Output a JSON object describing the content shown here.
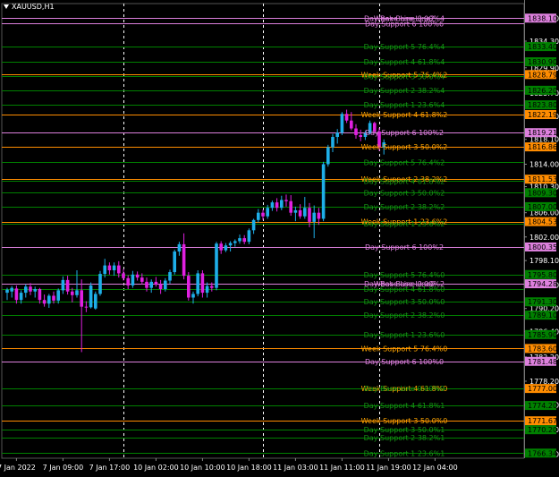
{
  "symbol_label": "XAUUSD,H1",
  "colors": {
    "background": "#000000",
    "bull_candle": "#1eaee8",
    "bear_candle": "#e020e0",
    "grid": "#ffffff",
    "axis_text": "#ffffff",
    "day_line": "#008000",
    "day_text": "#159315",
    "week_line": "#ff8c00",
    "week_text": "#ffa500",
    "pivot_line": "#dd80dd",
    "pivot_text": "#e080e0"
  },
  "chart_data": {
    "type": "candlestick",
    "symbol": "XAUUSD",
    "timeframe": "H1",
    "ylim": [
      1765.5,
      1840.5
    ],
    "price_ticks": [
      "1838.10",
      "1834.30",
      "1829.90",
      "1825.70",
      "1821.90",
      "1818.10",
      "1814.00",
      "1810.30",
      "1806.00",
      "1802.00",
      "1798.10",
      "1794.10",
      "1790.20",
      "1786.40",
      "1782.20",
      "1778.20",
      "1774.30",
      "1770.20",
      "1766.20"
    ],
    "time_labels": [
      {
        "label": "7 Jan 2022",
        "bar": 2
      },
      {
        "label": "7 Jan 09:00",
        "bar": 12
      },
      {
        "label": "7 Jan 17:00",
        "bar": 22
      },
      {
        "label": "10 Jan 02:00",
        "bar": 32
      },
      {
        "label": "10 Jan 10:00",
        "bar": 42
      },
      {
        "label": "10 Jan 18:00",
        "bar": 52
      },
      {
        "label": "11 Jan 03:00",
        "bar": 62
      },
      {
        "label": "11 Jan 11:00",
        "bar": 72
      },
      {
        "label": "11 Jan 19:00",
        "bar": 82
      },
      {
        "label": "12 Jan 04:00",
        "bar": 92
      }
    ],
    "period_separators": [
      25,
      55,
      80
    ],
    "candles": [
      {
        "o": 1792.8,
        "h": 1793.6,
        "l": 1791.6,
        "c": 1793.3
      },
      {
        "o": 1793.0,
        "h": 1793.9,
        "l": 1792.0,
        "c": 1793.6
      },
      {
        "o": 1793.5,
        "h": 1794.0,
        "l": 1791.0,
        "c": 1791.6
      },
      {
        "o": 1791.6,
        "h": 1793.2,
        "l": 1791.0,
        "c": 1792.8
      },
      {
        "o": 1792.8,
        "h": 1794.2,
        "l": 1792.0,
        "c": 1793.8
      },
      {
        "o": 1793.8,
        "h": 1794.4,
        "l": 1792.4,
        "c": 1793.0
      },
      {
        "o": 1793.0,
        "h": 1793.8,
        "l": 1792.0,
        "c": 1793.4
      },
      {
        "o": 1793.4,
        "h": 1793.6,
        "l": 1791.0,
        "c": 1791.6
      },
      {
        "o": 1791.6,
        "h": 1792.5,
        "l": 1790.5,
        "c": 1791.0
      },
      {
        "o": 1791.0,
        "h": 1792.6,
        "l": 1790.3,
        "c": 1792.3
      },
      {
        "o": 1792.3,
        "h": 1793.0,
        "l": 1791.0,
        "c": 1791.5
      },
      {
        "o": 1791.5,
        "h": 1793.5,
        "l": 1791.0,
        "c": 1793.2
      },
      {
        "o": 1793.2,
        "h": 1795.5,
        "l": 1792.6,
        "c": 1794.9
      },
      {
        "o": 1794.9,
        "h": 1795.6,
        "l": 1792.5,
        "c": 1793.0
      },
      {
        "o": 1793.0,
        "h": 1793.6,
        "l": 1791.2,
        "c": 1792.4
      },
      {
        "o": 1792.4,
        "h": 1796.5,
        "l": 1792.0,
        "c": 1793.2
      },
      {
        "o": 1793.2,
        "h": 1795.0,
        "l": 1783.0,
        "c": 1790.5
      },
      {
        "o": 1790.5,
        "h": 1791.4,
        "l": 1789.6,
        "c": 1790.4
      },
      {
        "o": 1790.4,
        "h": 1794.5,
        "l": 1790.2,
        "c": 1794.0
      },
      {
        "o": 1790.2,
        "h": 1793.0,
        "l": 1790.0,
        "c": 1792.6
      },
      {
        "o": 1792.6,
        "h": 1796.4,
        "l": 1792.3,
        "c": 1795.9
      },
      {
        "o": 1795.9,
        "h": 1798.4,
        "l": 1795.3,
        "c": 1797.3
      },
      {
        "o": 1797.3,
        "h": 1797.8,
        "l": 1795.8,
        "c": 1796.5
      },
      {
        "o": 1796.5,
        "h": 1797.8,
        "l": 1795.6,
        "c": 1797.3
      },
      {
        "o": 1797.3,
        "h": 1798.0,
        "l": 1795.3,
        "c": 1796.0
      },
      {
        "o": 1796.0,
        "h": 1796.7,
        "l": 1794.8,
        "c": 1795.2
      },
      {
        "o": 1795.2,
        "h": 1795.7,
        "l": 1793.4,
        "c": 1794.0
      },
      {
        "o": 1794.0,
        "h": 1796.4,
        "l": 1793.6,
        "c": 1795.8
      },
      {
        "o": 1795.8,
        "h": 1796.3,
        "l": 1794.8,
        "c": 1795.3
      },
      {
        "o": 1795.3,
        "h": 1796.0,
        "l": 1794.2,
        "c": 1794.6
      },
      {
        "o": 1794.6,
        "h": 1795.3,
        "l": 1793.0,
        "c": 1793.6
      },
      {
        "o": 1793.6,
        "h": 1795.0,
        "l": 1792.8,
        "c": 1794.6
      },
      {
        "o": 1794.6,
        "h": 1795.4,
        "l": 1793.8,
        "c": 1794.2
      },
      {
        "o": 1794.2,
        "h": 1794.9,
        "l": 1792.6,
        "c": 1793.4
      },
      {
        "o": 1793.4,
        "h": 1795.2,
        "l": 1793.0,
        "c": 1794.8
      },
      {
        "o": 1794.8,
        "h": 1796.6,
        "l": 1794.3,
        "c": 1796.2
      },
      {
        "o": 1796.2,
        "h": 1799.9,
        "l": 1795.8,
        "c": 1799.6
      },
      {
        "o": 1799.6,
        "h": 1801.2,
        "l": 1798.9,
        "c": 1800.8
      },
      {
        "o": 1800.8,
        "h": 1802.6,
        "l": 1795.0,
        "c": 1795.6
      },
      {
        "o": 1795.6,
        "h": 1796.2,
        "l": 1791.5,
        "c": 1792.0
      },
      {
        "o": 1792.0,
        "h": 1793.0,
        "l": 1791.0,
        "c": 1792.6
      },
      {
        "o": 1792.6,
        "h": 1796.5,
        "l": 1792.2,
        "c": 1796.0
      },
      {
        "o": 1796.0,
        "h": 1796.5,
        "l": 1792.0,
        "c": 1792.8
      },
      {
        "o": 1792.8,
        "h": 1794.5,
        "l": 1792.0,
        "c": 1793.9
      },
      {
        "o": 1793.9,
        "h": 1794.5,
        "l": 1793.0,
        "c": 1793.6
      },
      {
        "o": 1793.6,
        "h": 1801.2,
        "l": 1793.2,
        "c": 1800.9
      },
      {
        "o": 1800.9,
        "h": 1801.3,
        "l": 1799.2,
        "c": 1799.8
      },
      {
        "o": 1799.8,
        "h": 1801.0,
        "l": 1799.5,
        "c": 1800.6
      },
      {
        "o": 1800.6,
        "h": 1801.3,
        "l": 1799.6,
        "c": 1801.0
      },
      {
        "o": 1801.0,
        "h": 1801.6,
        "l": 1800.4,
        "c": 1801.3
      },
      {
        "o": 1801.3,
        "h": 1802.4,
        "l": 1800.9,
        "c": 1801.8
      },
      {
        "o": 1801.8,
        "h": 1802.3,
        "l": 1800.8,
        "c": 1801.2
      },
      {
        "o": 1801.2,
        "h": 1803.4,
        "l": 1800.8,
        "c": 1803.1
      },
      {
        "o": 1803.1,
        "h": 1805.0,
        "l": 1802.5,
        "c": 1804.8
      },
      {
        "o": 1804.8,
        "h": 1806.6,
        "l": 1804.4,
        "c": 1806.0
      },
      {
        "o": 1806.0,
        "h": 1806.5,
        "l": 1804.8,
        "c": 1805.4
      },
      {
        "o": 1805.4,
        "h": 1807.3,
        "l": 1805.0,
        "c": 1806.8
      },
      {
        "o": 1806.8,
        "h": 1808.0,
        "l": 1806.3,
        "c": 1807.7
      },
      {
        "o": 1807.7,
        "h": 1808.4,
        "l": 1806.2,
        "c": 1806.8
      },
      {
        "o": 1806.8,
        "h": 1808.8,
        "l": 1806.4,
        "c": 1808.1
      },
      {
        "o": 1808.1,
        "h": 1809.0,
        "l": 1807.0,
        "c": 1807.9
      },
      {
        "o": 1807.9,
        "h": 1808.9,
        "l": 1805.5,
        "c": 1806.0
      },
      {
        "o": 1806.0,
        "h": 1807.0,
        "l": 1804.6,
        "c": 1806.4
      },
      {
        "o": 1806.4,
        "h": 1807.4,
        "l": 1805.0,
        "c": 1805.4
      },
      {
        "o": 1805.4,
        "h": 1808.6,
        "l": 1805.0,
        "c": 1806.8
      },
      {
        "o": 1806.8,
        "h": 1807.6,
        "l": 1803.6,
        "c": 1804.5
      },
      {
        "o": 1804.5,
        "h": 1807.2,
        "l": 1801.8,
        "c": 1806.0
      },
      {
        "o": 1806.0,
        "h": 1806.8,
        "l": 1804.0,
        "c": 1805.0
      },
      {
        "o": 1805.0,
        "h": 1814.4,
        "l": 1804.6,
        "c": 1814.0
      },
      {
        "o": 1814.0,
        "h": 1817.2,
        "l": 1813.6,
        "c": 1816.8
      },
      {
        "o": 1816.8,
        "h": 1819.0,
        "l": 1816.0,
        "c": 1818.5
      },
      {
        "o": 1818.5,
        "h": 1819.8,
        "l": 1817.4,
        "c": 1819.2
      },
      {
        "o": 1819.2,
        "h": 1822.6,
        "l": 1818.8,
        "c": 1822.3
      },
      {
        "o": 1822.3,
        "h": 1823.0,
        "l": 1820.8,
        "c": 1821.2
      },
      {
        "o": 1821.2,
        "h": 1822.6,
        "l": 1819.6,
        "c": 1819.9
      },
      {
        "o": 1819.9,
        "h": 1820.6,
        "l": 1818.2,
        "c": 1818.8
      },
      {
        "o": 1818.8,
        "h": 1819.7,
        "l": 1817.8,
        "c": 1818.5
      },
      {
        "o": 1818.5,
        "h": 1819.5,
        "l": 1818.0,
        "c": 1819.1
      },
      {
        "o": 1819.1,
        "h": 1821.2,
        "l": 1818.9,
        "c": 1820.8
      },
      {
        "o": 1820.8,
        "h": 1821.0,
        "l": 1819.2,
        "c": 1819.4
      },
      {
        "o": 1819.4,
        "h": 1820.0,
        "l": 1816.2,
        "c": 1816.8
      },
      {
        "o": 1816.8,
        "h": 1818.1,
        "l": 1815.6,
        "c": 1817.6
      }
    ],
    "levels": [
      {
        "label": "Week Base Line2",
        "price": 1838.1,
        "kind": "pivot",
        "axis": "1838.10"
      },
      {
        "label": "Day Base Line 0.00%4",
        "price": 1838.1,
        "kind": "pivot"
      },
      {
        "label": "Day Support 6 100%6",
        "price": 1837.2,
        "kind": "pivot"
      },
      {
        "label": "Day Support 5 76.4%4",
        "price": 1833.4,
        "kind": "day",
        "axis": "1833.40"
      },
      {
        "label": "Day Support 4 61.8%4",
        "price": 1830.9,
        "kind": "day",
        "axis": "1830.90"
      },
      {
        "label": "Week Support 5 76.4%2",
        "price": 1828.79,
        "kind": "week",
        "axis": "1828.79"
      },
      {
        "label": "Day Support 3 50.0%4",
        "price": 1828.5,
        "kind": "day"
      },
      {
        "label": "Day Support 2 38.2%4",
        "price": 1826.2,
        "kind": "day",
        "axis": "1826.20"
      },
      {
        "label": "Day Support 1 23.6%4",
        "price": 1823.8,
        "kind": "day",
        "axis": "1823.80"
      },
      {
        "label": "Week Support 4 61.8%2",
        "price": 1822.19,
        "kind": "week",
        "axis": "1822.19"
      },
      {
        "label": "Day Support 6 100%2",
        "price": 1819.21,
        "kind": "pivot",
        "axis": "1819.21"
      },
      {
        "label": "Week Support 3 50.0%2",
        "price": 1816.86,
        "kind": "week",
        "axis": "1816.86"
      },
      {
        "label": "Day Support 5 76.4%2",
        "price": 1814.3,
        "kind": "day"
      },
      {
        "label": "Week Support 2 38.2%2",
        "price": 1811.53,
        "kind": "week",
        "axis": "1811.53"
      },
      {
        "label": "Day Support 4 61.8%2",
        "price": 1811.2,
        "kind": "day"
      },
      {
        "label": "Day Support 3 50.0%2",
        "price": 1809.3,
        "kind": "day",
        "axis": "1809.30"
      },
      {
        "label": "Day Support 2 38.2%2",
        "price": 1807.0,
        "kind": "day",
        "axis": "1807.00"
      },
      {
        "label": "Week Support 1 23.6%2",
        "price": 1804.53,
        "kind": "week",
        "axis": "1804.53"
      },
      {
        "label": "Day Support 1 23.6%2",
        "price": 1804.2,
        "kind": "day"
      },
      {
        "label": "Day Support 6 100%2",
        "price": 1800.35,
        "kind": "pivot",
        "axis": "1800.35"
      },
      {
        "label": "Day Support 5 76.4%0",
        "price": 1795.8,
        "kind": "day",
        "axis": "1795.80"
      },
      {
        "label": "Week Base Line0",
        "price": 1794.28,
        "kind": "pivot",
        "axis": "1794.28"
      },
      {
        "label": "Day Base Line 0.00%2",
        "price": 1794.28,
        "kind": "pivot"
      },
      {
        "label": "Day Support 4 61.8%0",
        "price": 1793.4,
        "kind": "day"
      },
      {
        "label": "Day Support 3 50.0%0",
        "price": 1791.3,
        "kind": "day",
        "axis": "1791.30"
      },
      {
        "label": "Day Support 2 38.2%0",
        "price": 1789.1,
        "kind": "day",
        "axis": "1789.10"
      },
      {
        "label": "Day Support 1 23.6%0",
        "price": 1785.9,
        "kind": "day",
        "axis": "1785.90"
      },
      {
        "label": "Week Support 5 76.4%0",
        "price": 1783.6,
        "kind": "week",
        "axis": "1783.60"
      },
      {
        "label": "Day Support 6 100%0",
        "price": 1781.48,
        "kind": "pivot",
        "axis": "1781.48"
      },
      {
        "label": "Week Support 4 61.8%0",
        "price": 1777.0,
        "kind": "week",
        "axis": "1777.00"
      },
      {
        "label": "Day Base Line 0.00%0",
        "price": 1777.0,
        "kind": "day"
      },
      {
        "label": "Day Support 4 61.8%1",
        "price": 1774.2,
        "kind": "day",
        "axis": "1774.20"
      },
      {
        "label": "Week Support 3 50.0%0",
        "price": 1771.67,
        "kind": "week",
        "axis": "1771.67"
      },
      {
        "label": "Day Support 3 50.0%1",
        "price": 1770.2,
        "kind": "day",
        "axis": "1770.20"
      },
      {
        "label": "Day Support 2 38.2%1",
        "price": 1768.9,
        "kind": "day"
      },
      {
        "label": "Day Support 1 23.6%1",
        "price": 1766.34,
        "kind": "day",
        "axis": "1766.34"
      }
    ]
  }
}
